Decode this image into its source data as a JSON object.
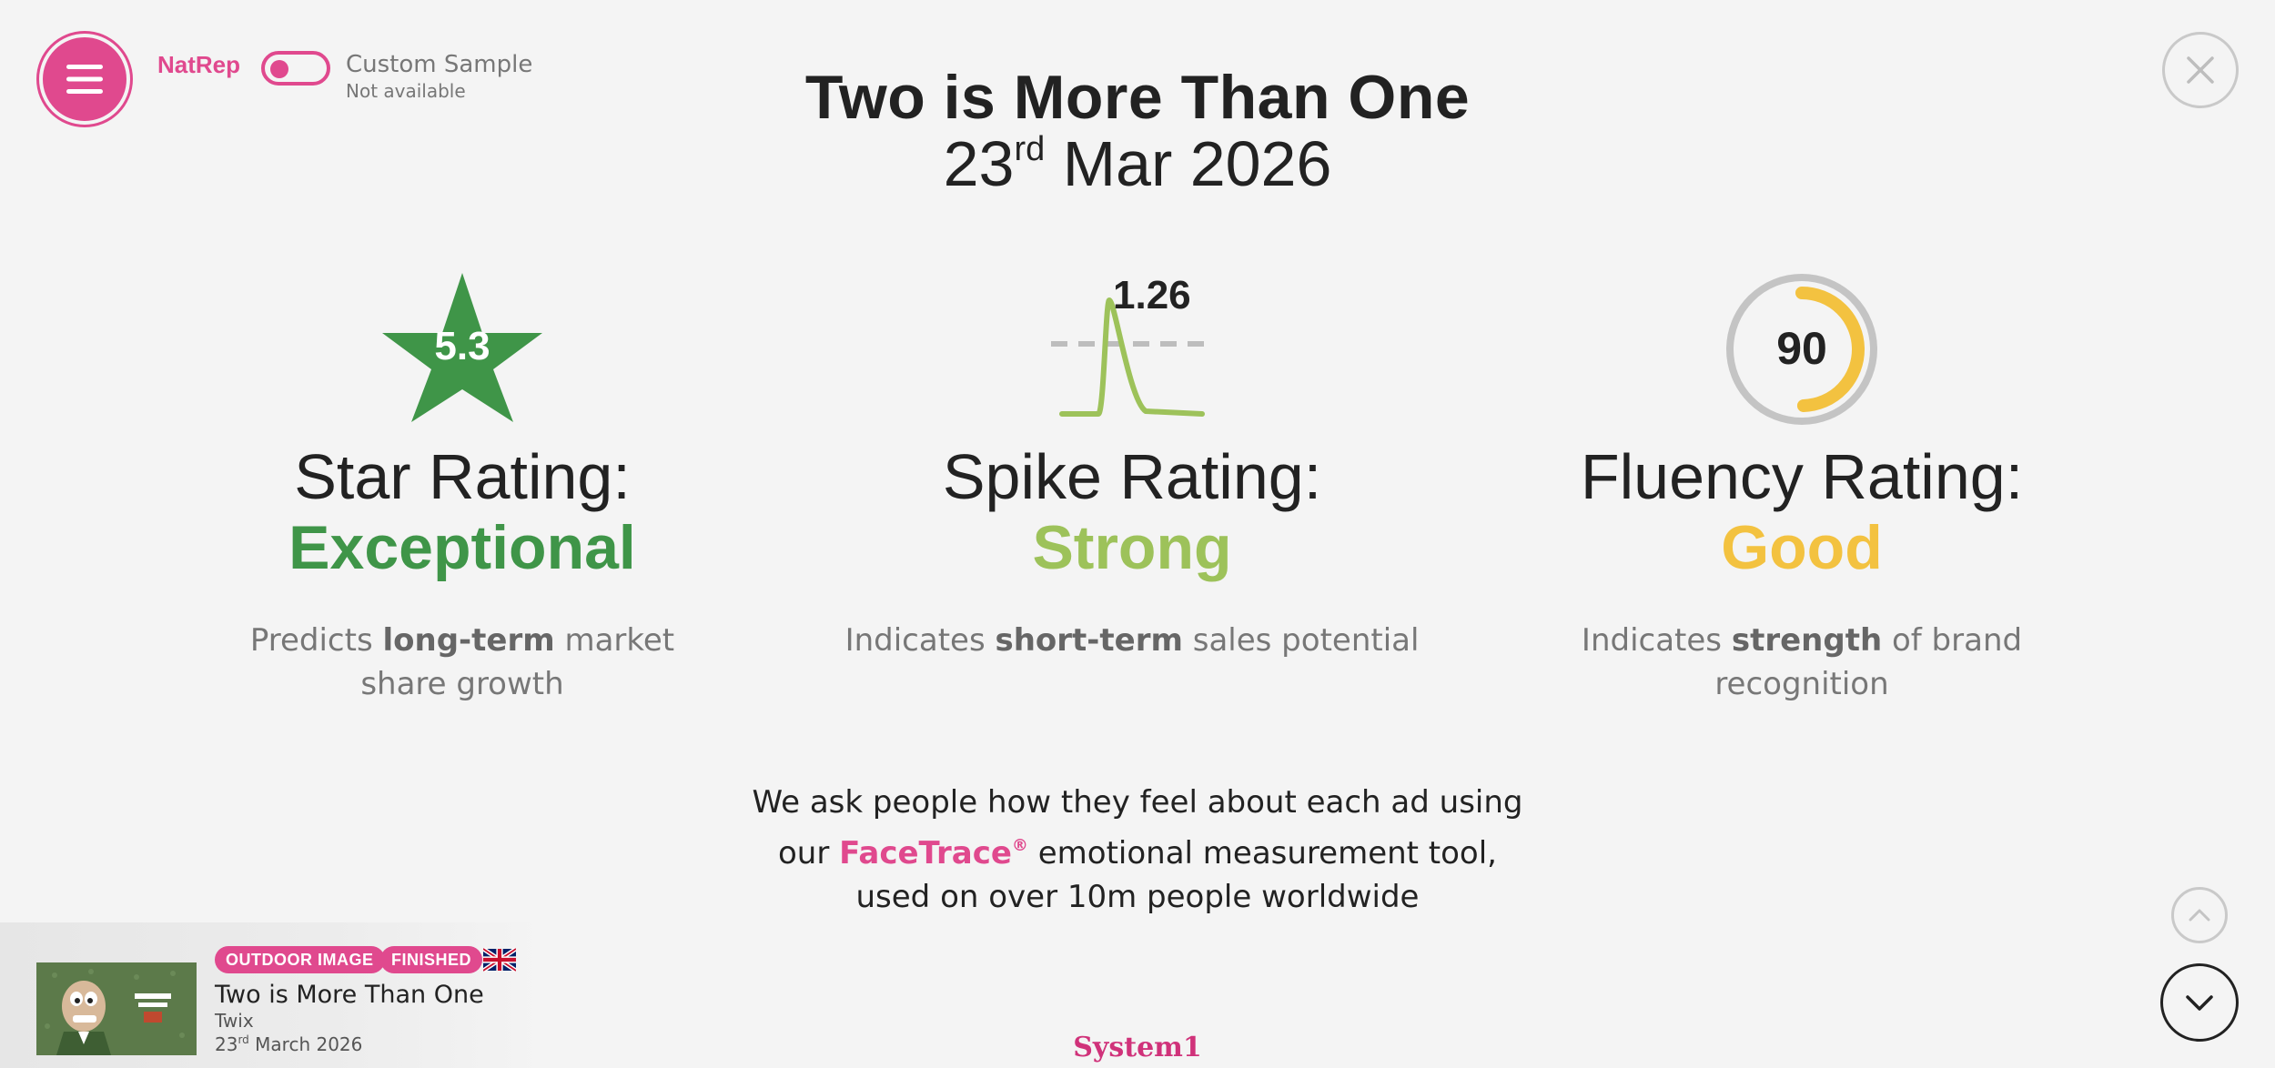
{
  "header": {
    "menu_icon": "hamburger-icon",
    "natrep_label": "NatRep",
    "custom_sample_label": "Custom Sample",
    "custom_sample_status": "Not available",
    "close_icon": "close-icon"
  },
  "report": {
    "title": "Two is More Than One",
    "date_day": "23",
    "date_suffix": "rd",
    "date_rest": " Mar 2026"
  },
  "ratings": {
    "star": {
      "icon": "star-icon",
      "score": "5.3",
      "title": "Star Rating:",
      "value": "Exceptional",
      "color": "#3f9548",
      "desc_pre": "Predicts ",
      "desc_bold": "long-term",
      "desc_post": " market share growth"
    },
    "spike": {
      "icon": "spike-chart-icon",
      "score": "1.26",
      "title": "Spike Rating:",
      "value": "Strong",
      "color": "#9dc25a",
      "desc_pre": "Indicates ",
      "desc_bold": "short-term",
      "desc_post": " sales potential"
    },
    "fluency": {
      "icon": "gauge-ring-icon",
      "score": "90",
      "level": 0.9,
      "title": "Fluency Rating:",
      "value": "Good",
      "color": "#f3c240",
      "desc_pre": "Indicates ",
      "desc_bold": "strength",
      "desc_post": " of brand recognition"
    }
  },
  "facetrace": {
    "line1": "We ask people how they feel about each ad using",
    "line2_pre": "our ",
    "brand": "FaceTrace",
    "reg": "®",
    "line2_post": " emotional measurement tool,",
    "line3": "used on over 10m people worldwide"
  },
  "ad": {
    "badge_type": "OUTDOOR IMAGE",
    "badge_status": "FINISHED",
    "flag_icon": "uk-flag-icon",
    "title": "Two is More Than One",
    "brand": "Twix",
    "date_day": "23",
    "date_suffix": "rd",
    "date_rest": " March 2026"
  },
  "navigation": {
    "scroll_up_icon": "chevron-up-icon",
    "scroll_down_icon": "chevron-down-icon"
  },
  "footer": {
    "logo": "System1"
  },
  "colors": {
    "accent": "#e0498e",
    "background": "#f4f4f4"
  }
}
